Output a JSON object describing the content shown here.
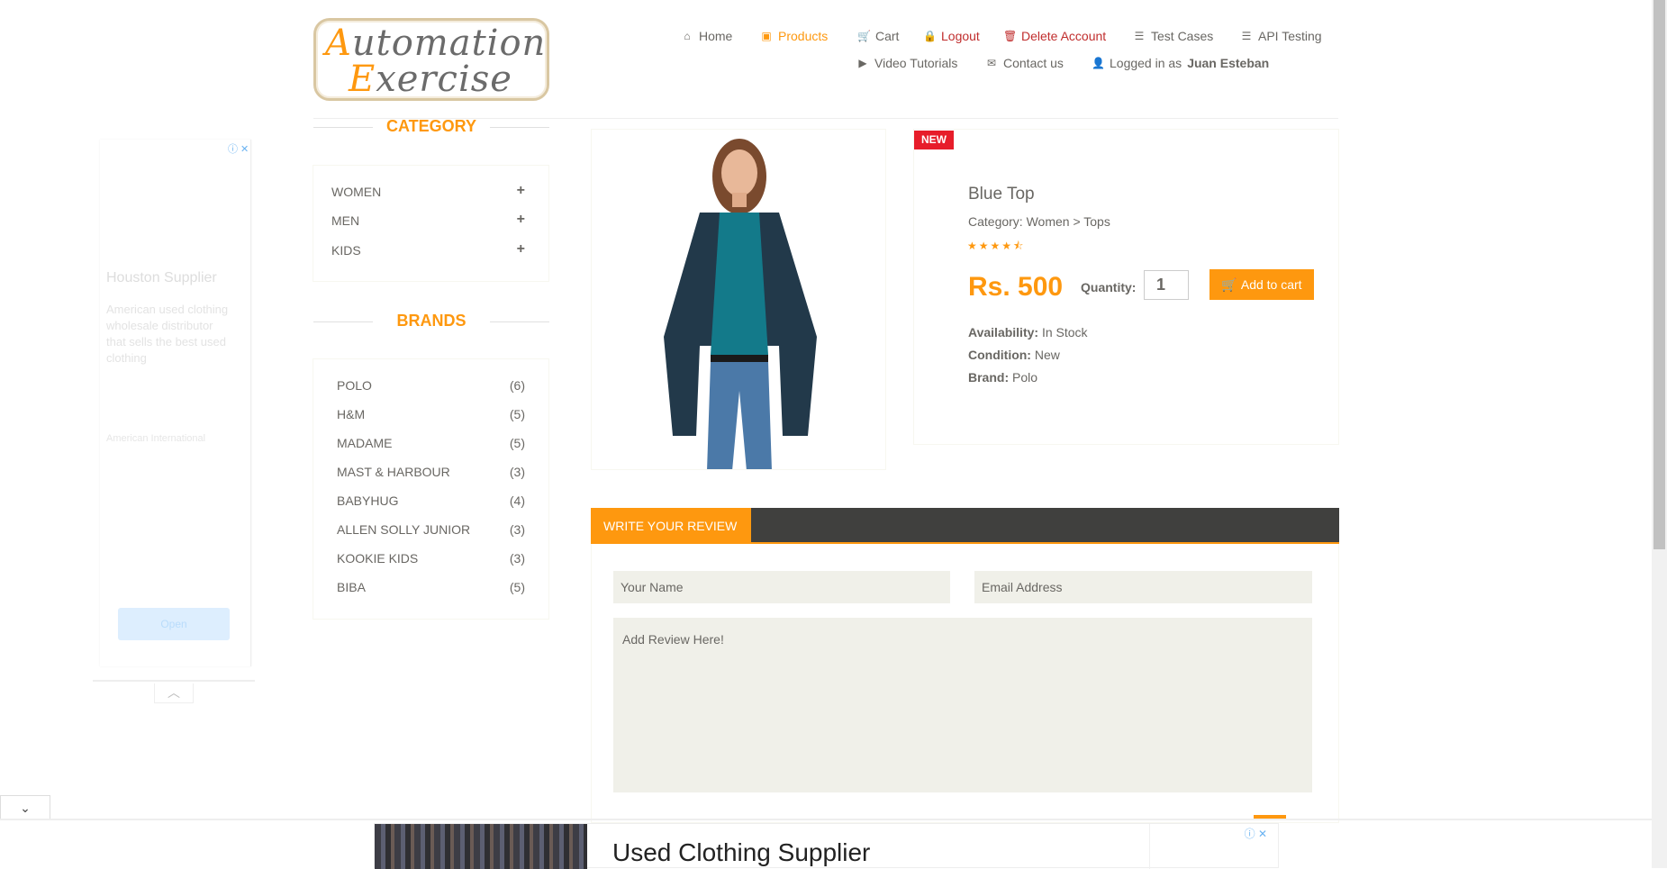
{
  "logo": {
    "line1": "utomation",
    "cap1": "A",
    "line2": "xercise",
    "cap2": "E"
  },
  "nav": {
    "home": "Home",
    "products": "Products",
    "cart": "Cart",
    "logout": "Logout",
    "delete_account": "Delete Account",
    "test_cases": "Test Cases",
    "api_testing": "API Testing",
    "video_tutorials": "Video Tutorials",
    "contact_us": "Contact us",
    "logged_in_prefix": "Logged in as",
    "username": "Juan Esteban"
  },
  "left_ad": {
    "title": "Houston Supplier",
    "desc": "American used clothing wholesale distributor that sells the best used clothing",
    "source": "American International",
    "open_label": "Open"
  },
  "sidebar": {
    "category_title": "CATEGORY",
    "categories": [
      "WOMEN",
      "MEN",
      "KIDS"
    ],
    "brands_title": "BRANDS",
    "brands": [
      {
        "name": "POLO",
        "count": "(6)"
      },
      {
        "name": "H&M",
        "count": "(5)"
      },
      {
        "name": "MADAME",
        "count": "(5)"
      },
      {
        "name": "MAST & HARBOUR",
        "count": "(3)"
      },
      {
        "name": "BABYHUG",
        "count": "(4)"
      },
      {
        "name": "ALLEN SOLLY JUNIOR",
        "count": "(3)"
      },
      {
        "name": "KOOKIE KIDS",
        "count": "(3)"
      },
      {
        "name": "BIBA",
        "count": "(5)"
      }
    ]
  },
  "product": {
    "badge": "NEW",
    "name": "Blue Top",
    "category": "Category: Women > Tops",
    "rating": 4.5,
    "price": "Rs. 500",
    "quantity_label": "Quantity:",
    "quantity": "1",
    "add_to_cart": "Add to cart",
    "availability_label": "Availability:",
    "availability": "In Stock",
    "condition_label": "Condition:",
    "condition": "New",
    "brand_label": "Brand:",
    "brand": "Polo"
  },
  "review": {
    "tab": "WRITE YOUR REVIEW",
    "name_placeholder": "Your Name",
    "email_placeholder": "Email Address",
    "review_placeholder": "Add Review Here!"
  },
  "bottom_ad": {
    "title": "Used Clothing Supplier"
  },
  "colors": {
    "accent": "#fe980f",
    "danger": "#c02d2d",
    "badge": "#e71d2a",
    "dark": "#40403e"
  }
}
